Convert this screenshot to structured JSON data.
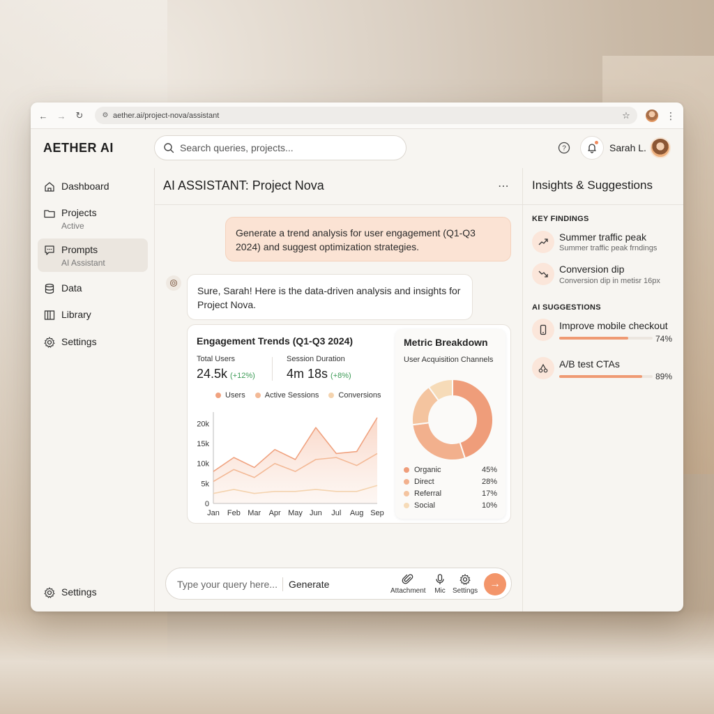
{
  "browser": {
    "url": "aether.ai/project-nova/assistant"
  },
  "app": {
    "brand": "AETHER AI",
    "search_placeholder": "Search queries, projects...",
    "user_name": "Sarah L."
  },
  "sidebar": {
    "items": [
      {
        "label": "Dashboard",
        "sub": "",
        "icon": "home-icon"
      },
      {
        "label": "Projects",
        "sub": "Active",
        "icon": "folder-icon"
      },
      {
        "label": "Prompts",
        "sub": "AI Assistant",
        "icon": "chat-icon"
      },
      {
        "label": "Data",
        "sub": "",
        "icon": "database-icon"
      },
      {
        "label": "Library",
        "sub": "",
        "icon": "library-icon"
      },
      {
        "label": "Settings",
        "sub": "",
        "icon": "gear-icon"
      }
    ],
    "active_index": 2,
    "bottom_settings": "Settings"
  },
  "main": {
    "title": "AI ASSISTANT: Project Nova",
    "user_message": "Generate a trend analysis for user engagement (Q1-Q3 2024) and suggest optimization strategies.",
    "assistant_message": "Sure, Sarah! Here is the data-driven analysis and insights for Project Nova."
  },
  "trends_card": {
    "title": "Engagement Trends (Q1-Q3 2024)",
    "stats": [
      {
        "label": "Total Users",
        "value": "24.5k",
        "delta": "(+12%)"
      },
      {
        "label": "Session Duration",
        "value": "4m 18s",
        "delta": "(+8%)"
      }
    ]
  },
  "chart_data": [
    {
      "type": "area",
      "title": "Engagement Trends (Q1-Q3 2024)",
      "categories": [
        "Jan",
        "Feb",
        "Mar",
        "Apr",
        "May",
        "Jun",
        "Jul",
        "Aug",
        "Sep"
      ],
      "yticks": [
        "0",
        "5k",
        "10k",
        "15k",
        "20k"
      ],
      "ylim": [
        0,
        22000
      ],
      "legend_placement": "top",
      "series": [
        {
          "name": "Users",
          "color": "#f0a27f",
          "values": [
            8000,
            11500,
            9000,
            13500,
            11000,
            19000,
            12500,
            13000,
            21500
          ]
        },
        {
          "name": "Active Sessions",
          "color": "#f3b996",
          "values": [
            5500,
            8500,
            6500,
            10000,
            8000,
            11000,
            11500,
            9500,
            12500
          ]
        },
        {
          "name": "Conversions",
          "color": "#f4d3ae",
          "values": [
            2500,
            3500,
            2500,
            3000,
            3000,
            3500,
            3000,
            3000,
            4500
          ]
        }
      ]
    },
    {
      "type": "pie",
      "title": "Metric Breakdown",
      "subtitle": "User Acquisition Channels",
      "slices": [
        {
          "label": "Organic",
          "value": 45,
          "display": "45%",
          "color": "#ef9d7a"
        },
        {
          "label": "Direct",
          "value": 28,
          "display": "28%",
          "color": "#f2b08d"
        },
        {
          "label": "Referral",
          "value": 17,
          "display": "17%",
          "color": "#f4c49f"
        },
        {
          "label": "Social",
          "value": 10,
          "display": "10%",
          "color": "#f6dbb8"
        }
      ]
    }
  ],
  "composer": {
    "placeholder": "Type your query here...",
    "generate": "Generate",
    "tools": [
      "Attachment",
      "Mic",
      "Settings"
    ]
  },
  "insights": {
    "title": "Insights & Suggestions",
    "findings_heading": "KEY FINDINGS",
    "findings": [
      {
        "name": "Summer traffic peak",
        "sub": "Summer traffic peak frndings",
        "icon": "trend-up-icon"
      },
      {
        "name": "Conversion dip",
        "sub": "Conversion dip in metisr 16px",
        "icon": "trend-down-icon"
      }
    ],
    "suggestions_heading": "AI SUGGESTIONS",
    "suggestions": [
      {
        "name": "Improve mobile checkout",
        "pct": "74%",
        "value": 0.74,
        "icon": "mobile-icon"
      },
      {
        "name": "A/B test CTAs",
        "pct": "89%",
        "value": 0.89,
        "icon": "ab-test-icon"
      }
    ]
  }
}
